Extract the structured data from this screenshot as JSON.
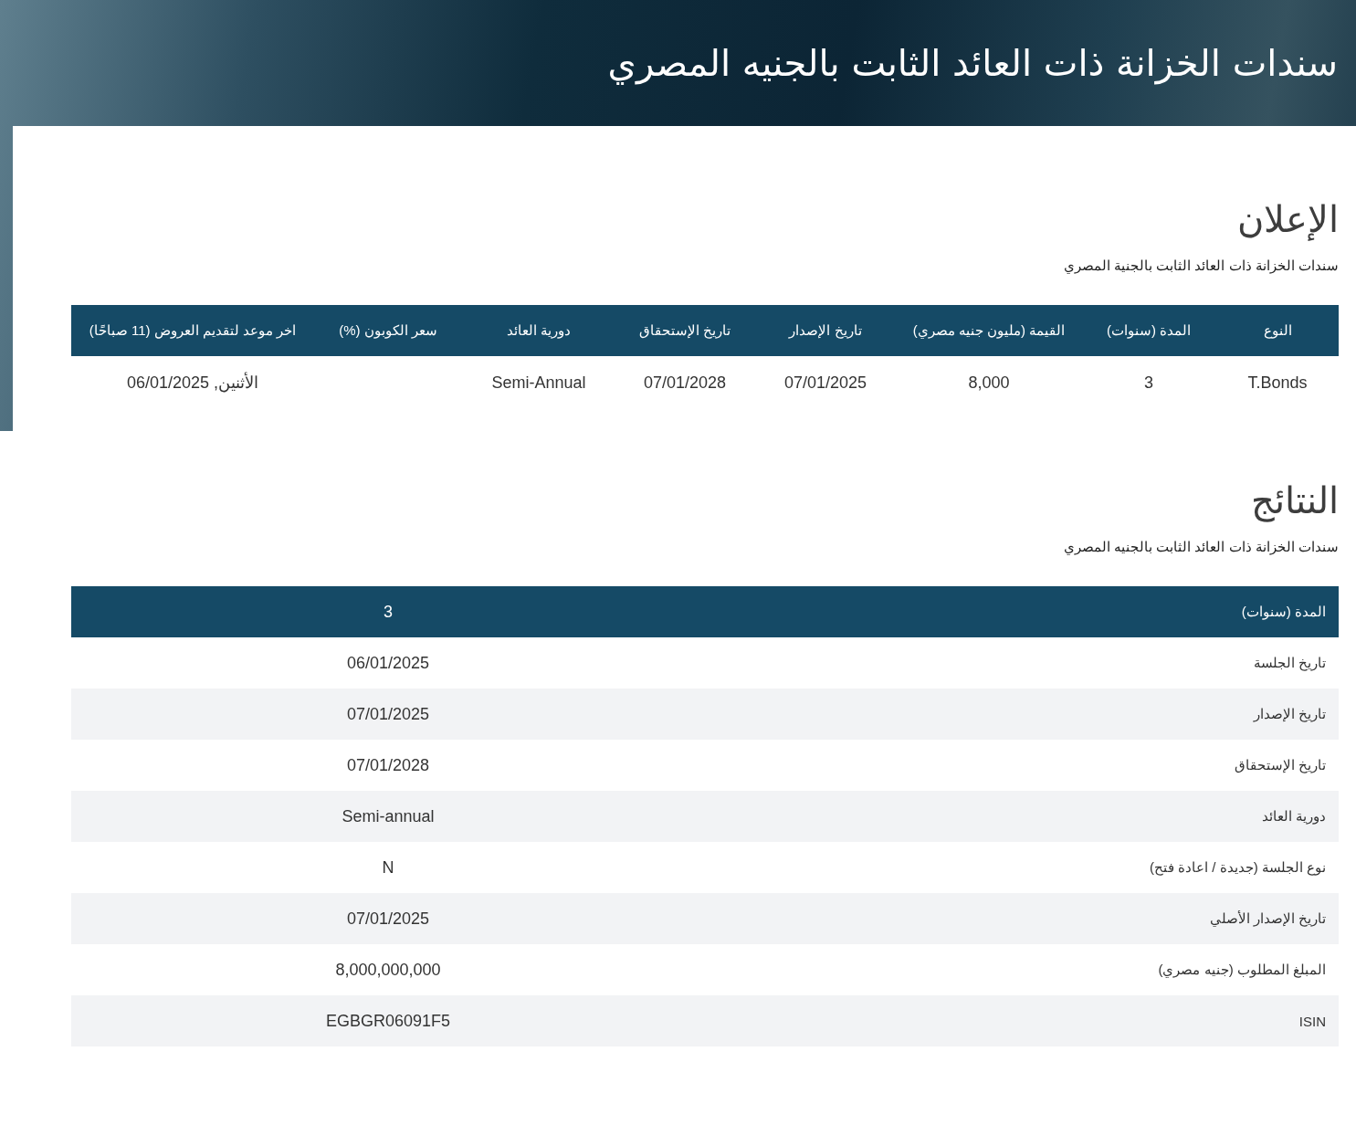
{
  "header": {
    "title": "سندات الخزانة ذات العائد الثابت بالجنيه المصري"
  },
  "announcement": {
    "heading": "الإعلان",
    "subtitle": "سندات الخزانة ذات العائد الثابت بالجنية المصري",
    "table": {
      "columns": [
        "النوع",
        "المدة (سنوات)",
        "القيمة (مليون جنيه مصري)",
        "تاريخ الإصدار",
        "تاريخ الإستحقاق",
        "دورية العائد",
        "سعر الكوبون (%)",
        "اخر موعد لتقديم العروض (11 صباحًا)"
      ],
      "rows": [
        {
          "cells": [
            "T.Bonds",
            "3",
            "8,000",
            "07/01/2025",
            "07/01/2028",
            "Semi-Annual",
            null,
            "الأثنين, 06/01/2025"
          ]
        }
      ]
    }
  },
  "results": {
    "heading": "النتائج",
    "subtitle": "سندات الخزانة ذات العائد الثابت بالجنيه المصري",
    "table": {
      "header": {
        "label": "المدة (سنوات)",
        "value": "3"
      },
      "rows": [
        {
          "label": "تاريخ الجلسة",
          "value": "06/01/2025"
        },
        {
          "label": "تاريخ الإصدار",
          "value": "07/01/2025"
        },
        {
          "label": "تاريخ الإستحقاق",
          "value": "07/01/2028"
        },
        {
          "label": "دورية العائد",
          "value": "Semi-annual"
        },
        {
          "label": "نوع الجلسة (جديدة / اعادة فتح)",
          "value": "N"
        },
        {
          "label": "تاريخ الإصدار الأصلي",
          "value": "07/01/2025"
        },
        {
          "label": "المبلغ المطلوب (جنيه مصري)",
          "value": "8,000,000,000"
        },
        {
          "label": "ISIN",
          "value": "EGBGR06091F5"
        }
      ]
    }
  }
}
